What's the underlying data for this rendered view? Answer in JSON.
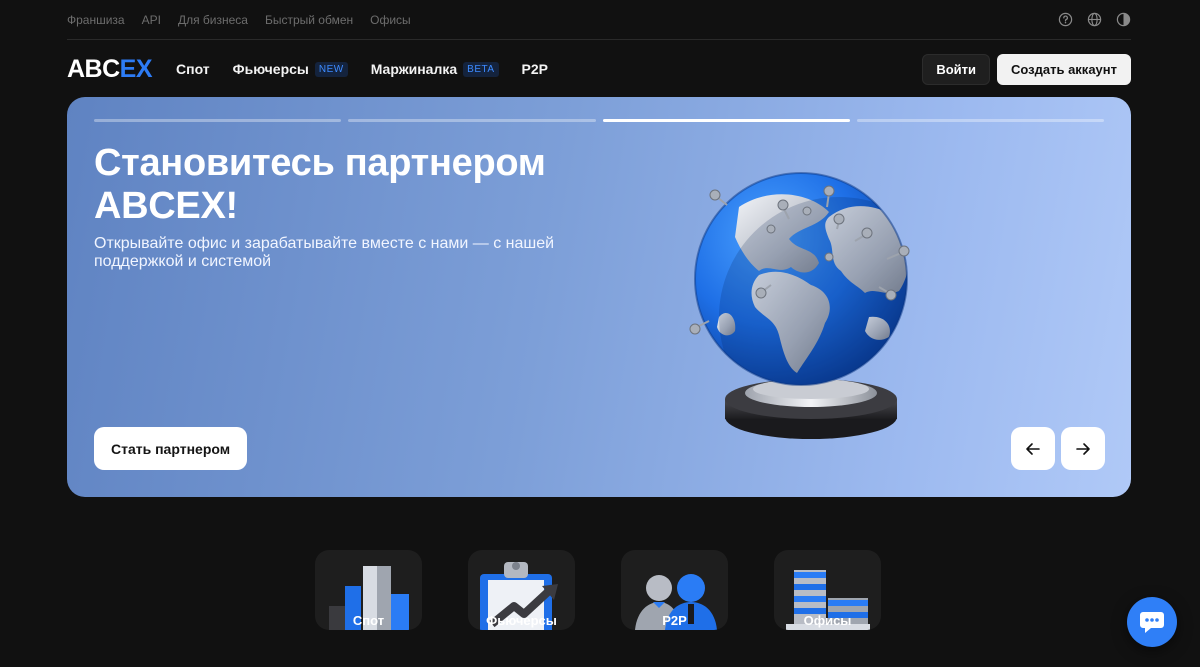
{
  "topbar": {
    "links": [
      "Франшиза",
      "API",
      "Для бизнеса",
      "Быстрый обмен",
      "Офисы"
    ]
  },
  "logo": {
    "part1": "ABC",
    "part2": "EX"
  },
  "nav": {
    "items": [
      {
        "label": "Спот",
        "badge": ""
      },
      {
        "label": "Фьючерсы",
        "badge": "NEW"
      },
      {
        "label": "Маржиналка",
        "badge": "BETA"
      },
      {
        "label": "P2P",
        "badge": ""
      }
    ],
    "login": "Войти",
    "signup": "Создать аккаунт"
  },
  "hero": {
    "title": "Становитесь партнером ABCEX!",
    "subtitle": "Открывайте офис и зарабатывайте вместе с нами — с нашей поддержкой и системой",
    "cta": "Стать партнером",
    "slides_total": 4,
    "active_slide": 3
  },
  "tiles": [
    {
      "label": "Спот",
      "icon": "bar-chart-icon"
    },
    {
      "label": "Фьючерсы",
      "icon": "clipboard-growth-icon"
    },
    {
      "label": "P2P",
      "icon": "users-icon"
    },
    {
      "label": "Офисы",
      "icon": "office-building-icon"
    }
  ],
  "colors": {
    "accent": "#2d7cf6",
    "background": "#111111"
  }
}
